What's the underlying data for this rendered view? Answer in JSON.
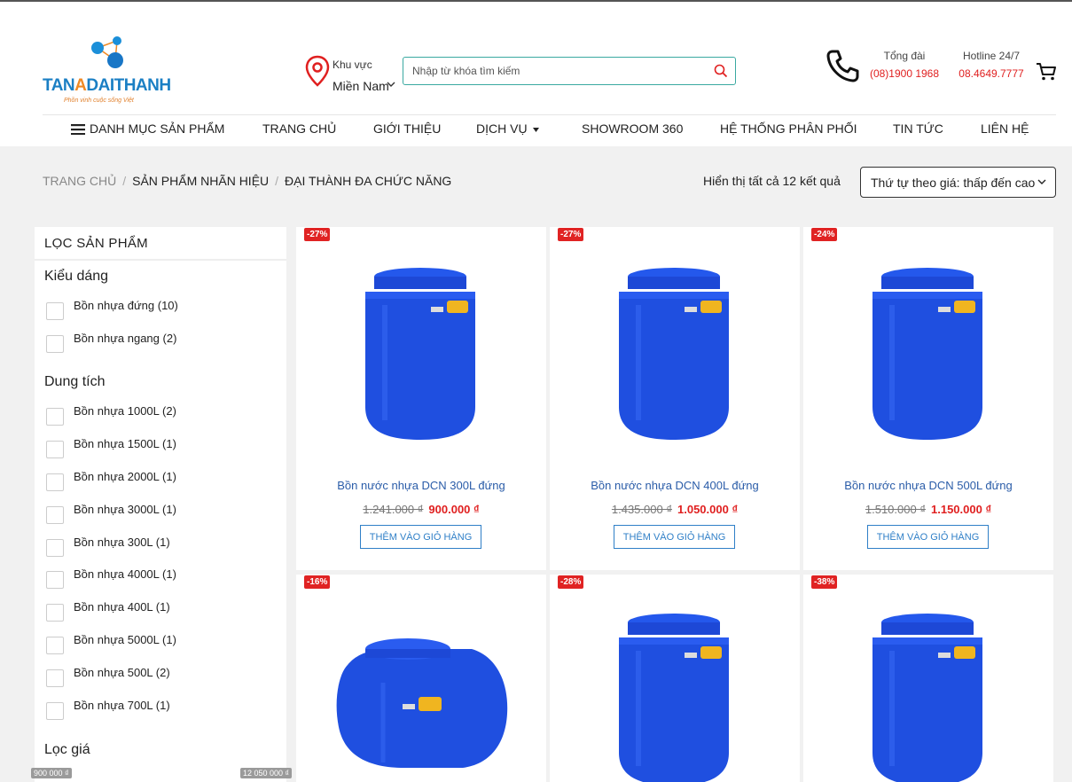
{
  "brand": {
    "name_part1": "TAN",
    "name_accent": "A",
    "name_part2": "DAITHANH",
    "tagline": "Phồn vinh cuộc sống Việt"
  },
  "header": {
    "region_label": "Khu vực",
    "region_value": "Miền Nam",
    "search_placeholder": "Nhập từ khóa tìm kiếm",
    "switchboard_label": "Tổng đài",
    "switchboard_value": "(08)1900 1968",
    "hotline_label": "Hotline 24/7",
    "hotline_value": "08.4649.7777"
  },
  "nav": {
    "categories": "DANH MỤC SẢN PHẨM",
    "home": "TRANG CHỦ",
    "about": "GIỚI THIỆU",
    "services": "DỊCH VỤ",
    "showroom": "SHOWROOM 360",
    "distribution": "HỆ THỐNG PHÂN PHỐI",
    "news": "TIN TỨC",
    "contact": "LIÊN HỆ"
  },
  "breadcrumb": {
    "home": "TRANG CHỦ",
    "sep": "/",
    "brand": "SẢN PHẨM NHÃN HIỆU",
    "current": "ĐẠI THÀNH ĐA CHỨC NĂNG"
  },
  "results": "Hiển thị tất cả 12 kết quả",
  "sort": "Thứ tự theo giá: thấp đến cao",
  "filter": {
    "title": "LỌC SẢN PHẨM",
    "style_title": "Kiểu dáng",
    "styles": [
      "Bồn nhựa đứng (10)",
      "Bồn nhựa ngang (2)"
    ],
    "capacity_title": "Dung tích",
    "capacities": [
      "Bồn nhựa 1000L (2)",
      "Bồn nhựa 1500L (1)",
      "Bồn nhựa 2000L (1)",
      "Bồn nhựa 3000L (1)",
      "Bồn nhựa 300L (1)",
      "Bồn nhựa 4000L (1)",
      "Bồn nhựa 400L (1)",
      "Bồn nhựa 5000L (1)",
      "Bồn nhựa 500L (2)",
      "Bồn nhựa 700L (1)"
    ],
    "price_title": "Lọc giá",
    "price_min": "900 000 ₫",
    "price_max": "12 050 000 ₫"
  },
  "add_to_cart": "THÊM VÀO GIỎ HÀNG",
  "products": [
    {
      "badge": "-27%",
      "name": "Bồn nước nhựa DCN 300L đứng",
      "old": "1.241.000 ₫",
      "new": "900.000 ₫"
    },
    {
      "badge": "-27%",
      "name": "Bồn nước nhựa DCN 400L đứng",
      "old": "1.435.000 ₫",
      "new": "1.050.000 ₫"
    },
    {
      "badge": "-24%",
      "name": "Bồn nước nhựa DCN 500L đứng",
      "old": "1.510.000 ₫",
      "new": "1.150.000 ₫"
    },
    {
      "badge": "-16%"
    },
    {
      "badge": "-28%"
    },
    {
      "badge": "-38%"
    }
  ],
  "colors": {
    "accent_blue": "#2f7fc7",
    "price_red": "#e02020",
    "tank_blue": "#1f4fe0"
  }
}
